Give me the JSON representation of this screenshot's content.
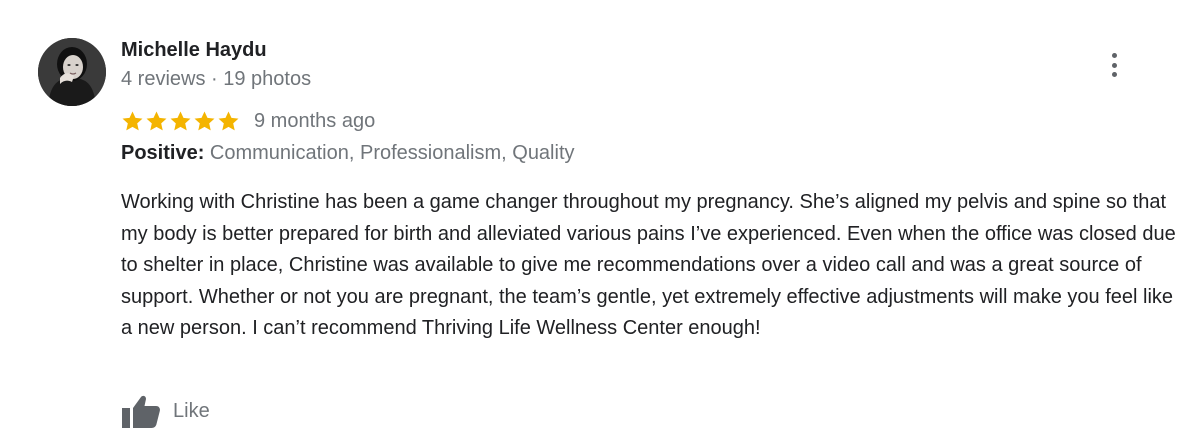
{
  "review": {
    "author": "Michelle Haydu",
    "meta": "4 reviews · 19 photos",
    "rating": 5,
    "rating_max": 5,
    "time": "9 months ago",
    "positive_label": "Positive:",
    "positive_values": "Communication, Professionalism, Quality",
    "text": "Working with Christine has been a game changer throughout my pregnancy. She’s aligned my pelvis and spine so that my body is better prepared for birth and alleviated various pains I’ve experienced. Even when the office was closed due to shelter in place, Christine was available to give me recommendations over a video call and was a great source of support. Whether or not you are pregnant, the team’s gentle, yet extremely effective adjustments will make you feel like a new person. I can’t recommend Thriving Life Wellness Center enough!",
    "like_label": "Like"
  },
  "icons": {
    "star": "star-icon",
    "more": "more-vert-icon",
    "like": "thumbs-up-icon"
  },
  "colors": {
    "star": "#f4b400",
    "secondary_text": "#70757a",
    "icon": "#5f6368"
  }
}
